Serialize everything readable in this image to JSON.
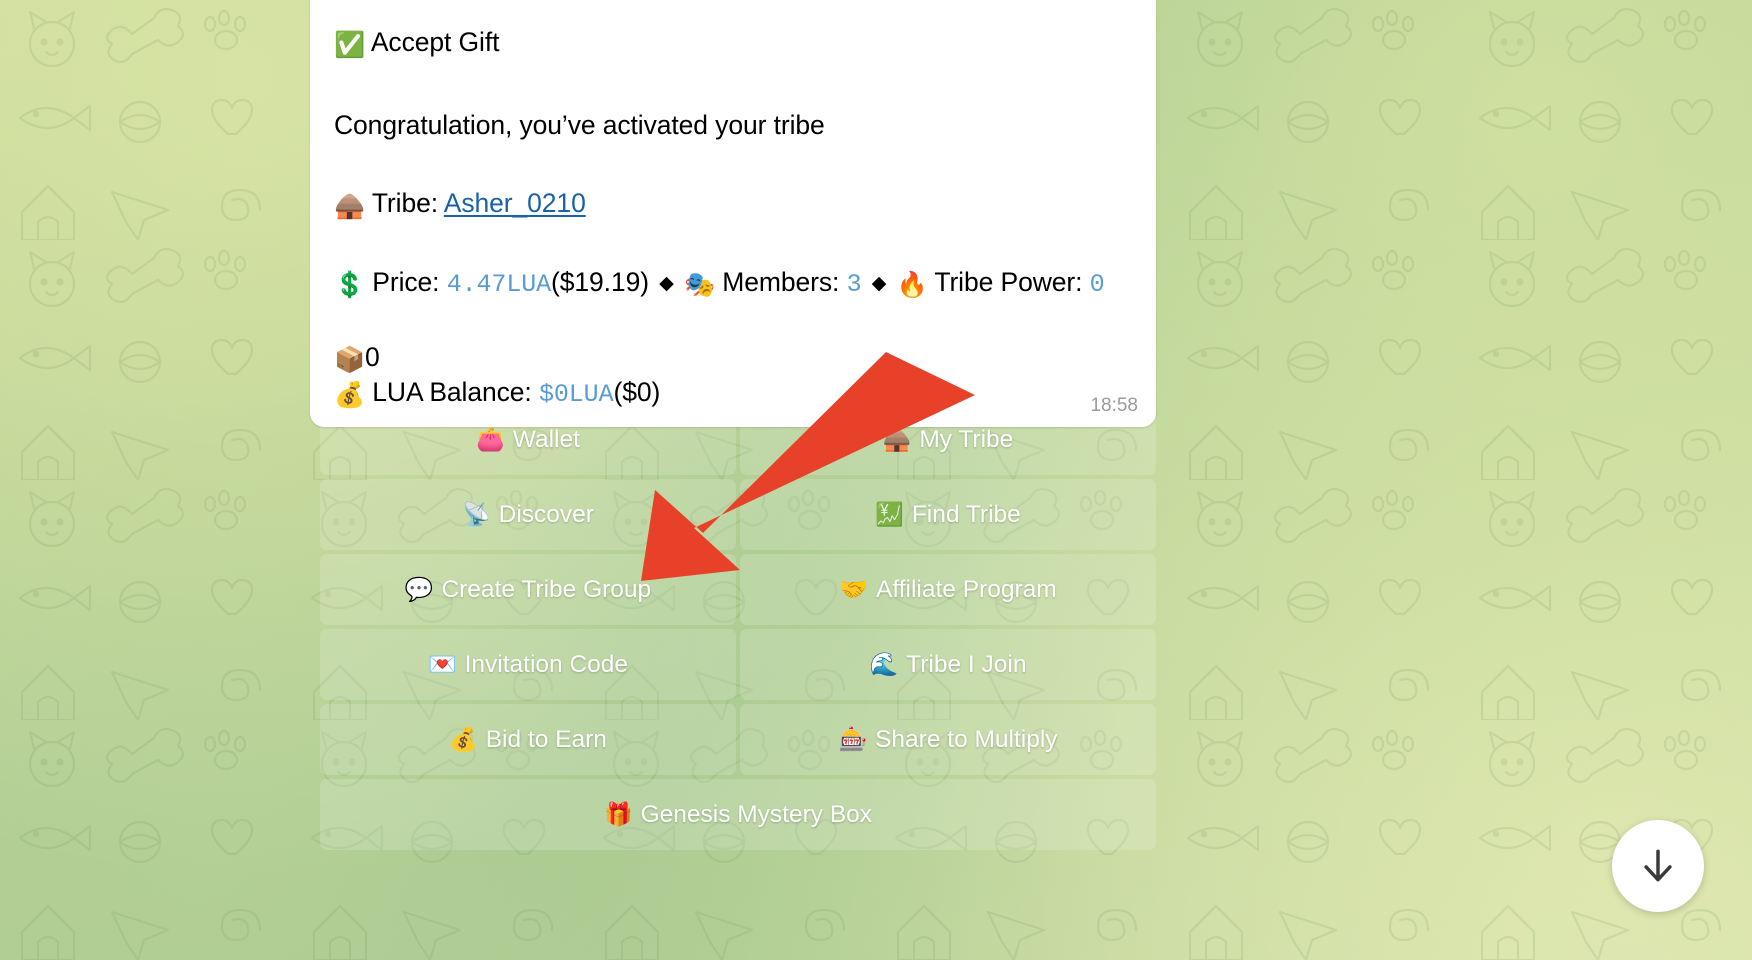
{
  "app": "telegram-chat",
  "message": {
    "title_emoji": "✅",
    "title": "Accept Gift",
    "congrats": "Congratulation, you’ve activated your tribe",
    "tribe_emoji": "🛖",
    "tribe_label": "Tribe:",
    "tribe_name": "Asher_0210",
    "price_emoji": "💲",
    "price_label": "Price:",
    "price_value": "4.47LUA",
    "price_usd": "($19.19)",
    "separator": "◆",
    "members_emoji": "🎭",
    "members_label": "Members:",
    "members_value": "3",
    "power_emoji": "🔥",
    "power_label": "Tribe Power:",
    "power_value": "0",
    "box_emoji": "📦",
    "box_value": "0",
    "balance_emoji": "💰",
    "balance_label": "LUA Balance:",
    "balance_value": "$0LUA",
    "balance_usd": "($0)",
    "timestamp": "18:58"
  },
  "keyboard": {
    "rows": [
      [
        {
          "emoji": "👛",
          "label": "Wallet"
        },
        {
          "emoji": "🛖",
          "label": "My Tribe"
        }
      ],
      [
        {
          "emoji": "📡",
          "label": "Discover"
        },
        {
          "emoji": "💹",
          "label": "Find Tribe"
        }
      ],
      [
        {
          "emoji": "💬",
          "label": "Create Tribe Group"
        },
        {
          "emoji": "🤝",
          "label": "Affiliate Program"
        }
      ],
      [
        {
          "emoji": "💌",
          "label": "Invitation Code"
        },
        {
          "emoji": "🌊",
          "label": "Tribe I Join"
        }
      ],
      [
        {
          "emoji": "💰",
          "label": "Bid to Earn"
        },
        {
          "emoji": "🎰",
          "label": "Share to Multiply"
        }
      ],
      [
        {
          "emoji": "🎁",
          "label": "Genesis Mystery Box"
        }
      ]
    ]
  },
  "colors": {
    "link": "#1a62a8",
    "code": "#5b9bd5",
    "arrow": "#e8412a",
    "bubble": "#ffffff"
  }
}
